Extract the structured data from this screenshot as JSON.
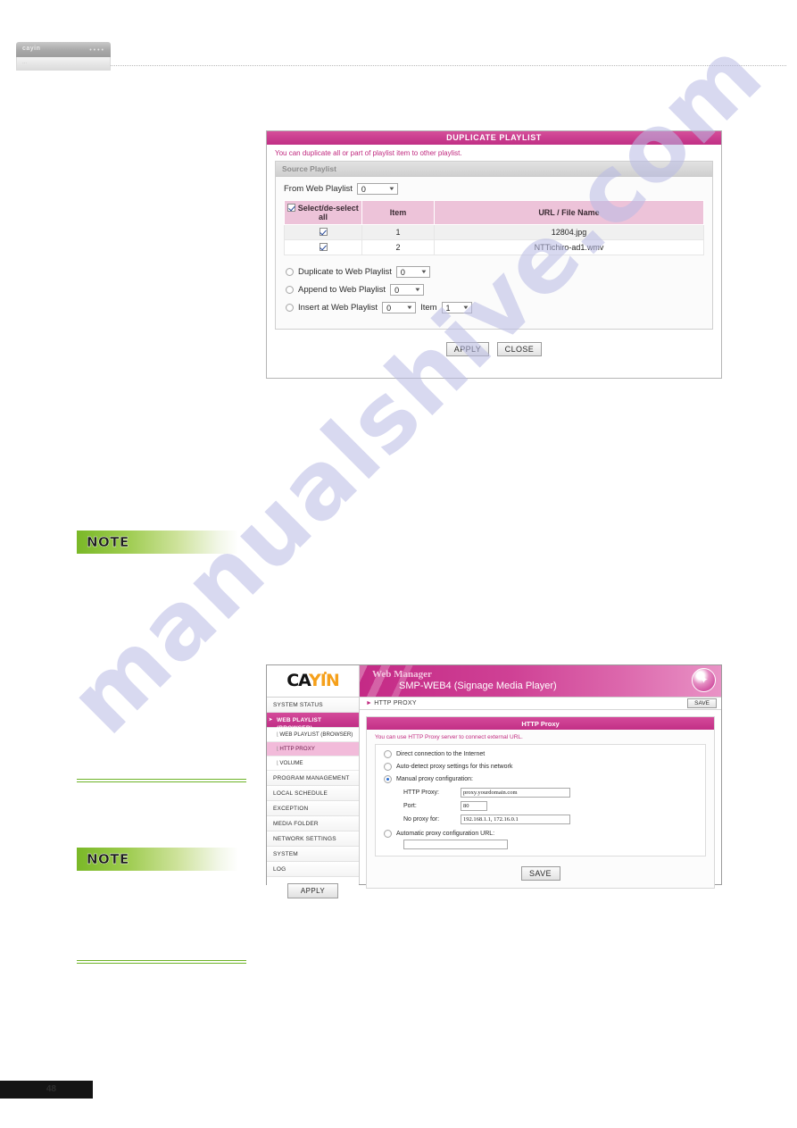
{
  "page": {
    "watermark": "manualshive.com",
    "footer_page_number": "48",
    "browser_chrome": {
      "logo": "cayin",
      "dots": "••••",
      "body_hint": "..."
    },
    "notes": [
      {
        "label": "NOTE"
      },
      {
        "label": "NOTE"
      }
    ]
  },
  "duplicate_playlist_dialog": {
    "title": "DUPLICATE PLAYLIST",
    "hint": "You can duplicate all or part of playlist item to other playlist.",
    "source_section": {
      "header": "Source Playlist",
      "from_label": "From Web Playlist",
      "from_value": "0"
    },
    "table": {
      "columns": [
        "Select/de-select all",
        "Item",
        "URL / File Name"
      ],
      "select_all_checked": true,
      "rows": [
        {
          "checked": true,
          "item": "1",
          "name": "12804.jpg"
        },
        {
          "checked": true,
          "item": "2",
          "name": "NTTichiro-ad1.wmv"
        }
      ]
    },
    "destination_options": [
      {
        "label": "Duplicate to Web Playlist",
        "selected": false,
        "playlist_value": "0",
        "item_label": null,
        "item_value": null
      },
      {
        "label": "Append to Web Playlist",
        "selected": false,
        "playlist_value": "0",
        "item_label": null,
        "item_value": null
      },
      {
        "label": "Insert at Web Playlist",
        "selected": false,
        "playlist_value": "0",
        "item_label": "Item",
        "item_value": "1"
      }
    ],
    "buttons": {
      "apply": "APPLY",
      "close": "CLOSE"
    }
  },
  "web_manager": {
    "logo_text_dark": "CA",
    "logo_text_orange": "YIN",
    "banner_title": "Web Manager",
    "banner_subtitle": "SMP-WEB4 (Signage Media Player)",
    "wizard_icon": "wizard-star-icon",
    "sidebar": {
      "items": [
        {
          "label": "SYSTEM STATUS",
          "type": "top",
          "active": false
        },
        {
          "label": "WEB PLAYLIST (BROWSER)",
          "type": "top",
          "active": true
        },
        {
          "label": "WEB PLAYLIST (BROWSER)",
          "type": "sub",
          "active": false
        },
        {
          "label": "HTTP PROXY",
          "type": "sub",
          "active": true
        },
        {
          "label": "VOLUME",
          "type": "sub",
          "active": false
        },
        {
          "label": "PROGRAM MANAGEMENT",
          "type": "top",
          "active": false
        },
        {
          "label": "LOCAL SCHEDULE",
          "type": "top",
          "active": false
        },
        {
          "label": "EXCEPTION",
          "type": "top",
          "active": false
        },
        {
          "label": "MEDIA FOLDER",
          "type": "top",
          "active": false
        },
        {
          "label": "NETWORK SETTINGS",
          "type": "top",
          "active": false
        },
        {
          "label": "SYSTEM",
          "type": "top",
          "active": false
        },
        {
          "label": "LOG",
          "type": "top",
          "active": false
        }
      ],
      "apply_button": "APPLY"
    },
    "breadcrumb": "HTTP PROXY",
    "top_save_button": "SAVE",
    "panel": {
      "header": "HTTP Proxy",
      "hint": "You can use HTTP Proxy server to connect external URL.",
      "options": [
        {
          "label": "Direct connection to the Internet",
          "selected": false
        },
        {
          "label": "Auto-detect proxy settings for this network",
          "selected": false
        },
        {
          "label": "Manual proxy configuration:",
          "selected": true
        },
        {
          "label": "Automatic proxy configuration URL:",
          "selected": false
        }
      ],
      "fields": [
        {
          "label": "HTTP Proxy:",
          "value": "proxy.yourdomain.com"
        },
        {
          "label": "Port:",
          "value": "80"
        },
        {
          "label": "No proxy for:",
          "value": "192.168.1.1, 172.16.0.1"
        }
      ],
      "auto_config_url_value": "",
      "save_button": "SAVE"
    }
  },
  "colors": {
    "magenta": "#c42a86",
    "pink_header": "#edc3d9",
    "green": "#6db227",
    "orange": "#f5a01b",
    "watermark": "#b9bbe4"
  }
}
